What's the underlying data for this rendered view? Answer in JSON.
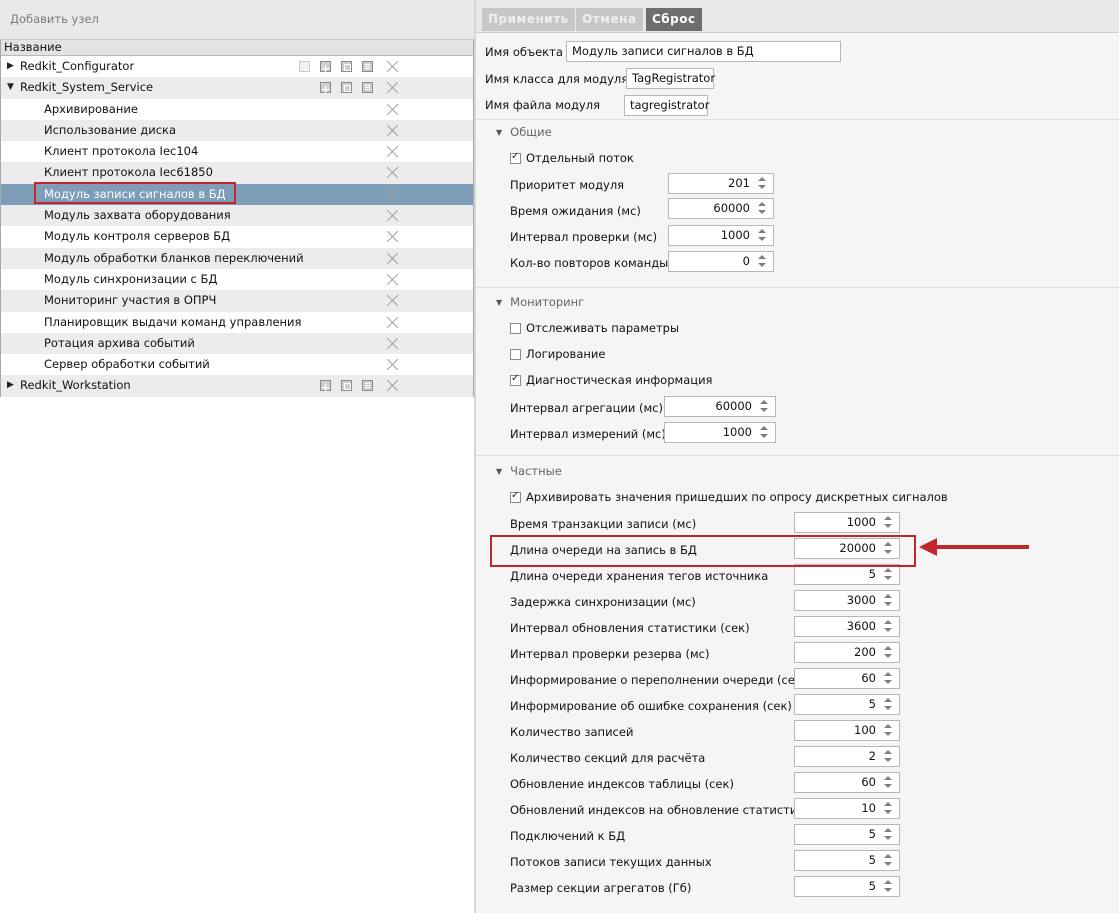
{
  "left": {
    "add_node_label": "Добавить узел",
    "tree_header": "Название",
    "rows": [
      {
        "label": "Redkit_Configurator",
        "kind": "parent",
        "expanded": false
      },
      {
        "label": "Redkit_System_Service",
        "kind": "parent",
        "expanded": true
      },
      {
        "label": "Архивирование",
        "kind": "child"
      },
      {
        "label": "Использование диска",
        "kind": "child"
      },
      {
        "label": "Клиент протокола Iec104",
        "kind": "child"
      },
      {
        "label": "Клиент протокола Iec61850",
        "kind": "child"
      },
      {
        "label": "Модуль записи сигналов в БД",
        "kind": "child",
        "selected": true
      },
      {
        "label": "Модуль захвата оборудования",
        "kind": "child"
      },
      {
        "label": "Модуль контроля серверов БД",
        "kind": "child"
      },
      {
        "label": "Модуль обработки бланков переключений",
        "kind": "child"
      },
      {
        "label": "Модуль синхронизации с БД",
        "kind": "child"
      },
      {
        "label": "Мониторинг участия в ОПРЧ",
        "kind": "child"
      },
      {
        "label": "Планировщик выдачи команд управления",
        "kind": "child"
      },
      {
        "label": "Ротация архива событий",
        "kind": "child"
      },
      {
        "label": "Сервер обработки событий",
        "kind": "child"
      },
      {
        "label": "Redkit_Workstation",
        "kind": "parent",
        "expanded": false
      }
    ]
  },
  "toolbar": {
    "apply_label": "Применить",
    "cancel_label": "Отмена",
    "reset_label": "Сброс"
  },
  "object": {
    "name_label": "Имя объекта",
    "name_value": "Модуль записи сигналов в БД",
    "class_label": "Имя класса для модуля",
    "class_value": "TagRegistrator",
    "file_label": "Имя файла модуля",
    "file_value": "tagregistrator"
  },
  "general": {
    "title": "Общие",
    "separate_thread_label": "Отдельный поток",
    "separate_thread_checked": true,
    "fields": [
      {
        "label": "Приоритет модуля",
        "value": "201"
      },
      {
        "label": "Время ожидания (мс)",
        "value": "60000"
      },
      {
        "label": "Интервал проверки (мс)",
        "value": "1000"
      },
      {
        "label": "Кол-во повторов команды",
        "value": "0"
      }
    ]
  },
  "monitoring": {
    "title": "Мониторинг",
    "checkboxes": [
      {
        "label": "Отслеживать параметры",
        "checked": false
      },
      {
        "label": "Логирование",
        "checked": false
      },
      {
        "label": "Диагностическая информация",
        "checked": true
      }
    ],
    "fields": [
      {
        "label": "Интервал агрегации (мс)",
        "value": "60000"
      },
      {
        "label": "Интервал измерений (мс)",
        "value": "1000"
      }
    ]
  },
  "private": {
    "title": "Частные",
    "archive_label": "Архивировать значения пришедших по опросу дискретных сигналов",
    "archive_checked": true,
    "fields": [
      {
        "label": "Время транзакции записи (мс)",
        "value": "1000"
      },
      {
        "label": "Длина очереди на запись в БД",
        "value": "20000"
      },
      {
        "label": "Длина очереди хранения тегов источника",
        "value": "5"
      },
      {
        "label": "Задержка синхронизации (мс)",
        "value": "3000"
      },
      {
        "label": "Интервал обновления статистики (сек)",
        "value": "3600"
      },
      {
        "label": "Интервал проверки резерва (мс)",
        "value": "200"
      },
      {
        "label": "Информирование о переполнении очереди (сек)",
        "value": "60"
      },
      {
        "label": "Информирование об ошибке сохранения (сек)",
        "value": "5"
      },
      {
        "label": "Количество записей",
        "value": "100"
      },
      {
        "label": "Количество секций для расчёта",
        "value": "2"
      },
      {
        "label": "Обновление индексов таблицы (сек)",
        "value": "60"
      },
      {
        "label": "Обновлений индексов на обновление статистики",
        "value": "10"
      },
      {
        "label": "Подключений к БД",
        "value": "5"
      },
      {
        "label": "Потоков записи текущих данных",
        "value": "5"
      },
      {
        "label": "Размер секции агрегатов (Гб)",
        "value": "5"
      }
    ]
  },
  "colors": {
    "selection": "#7d9db8",
    "highlight": "#c0262c",
    "reset_button": "#6e6e6e"
  }
}
